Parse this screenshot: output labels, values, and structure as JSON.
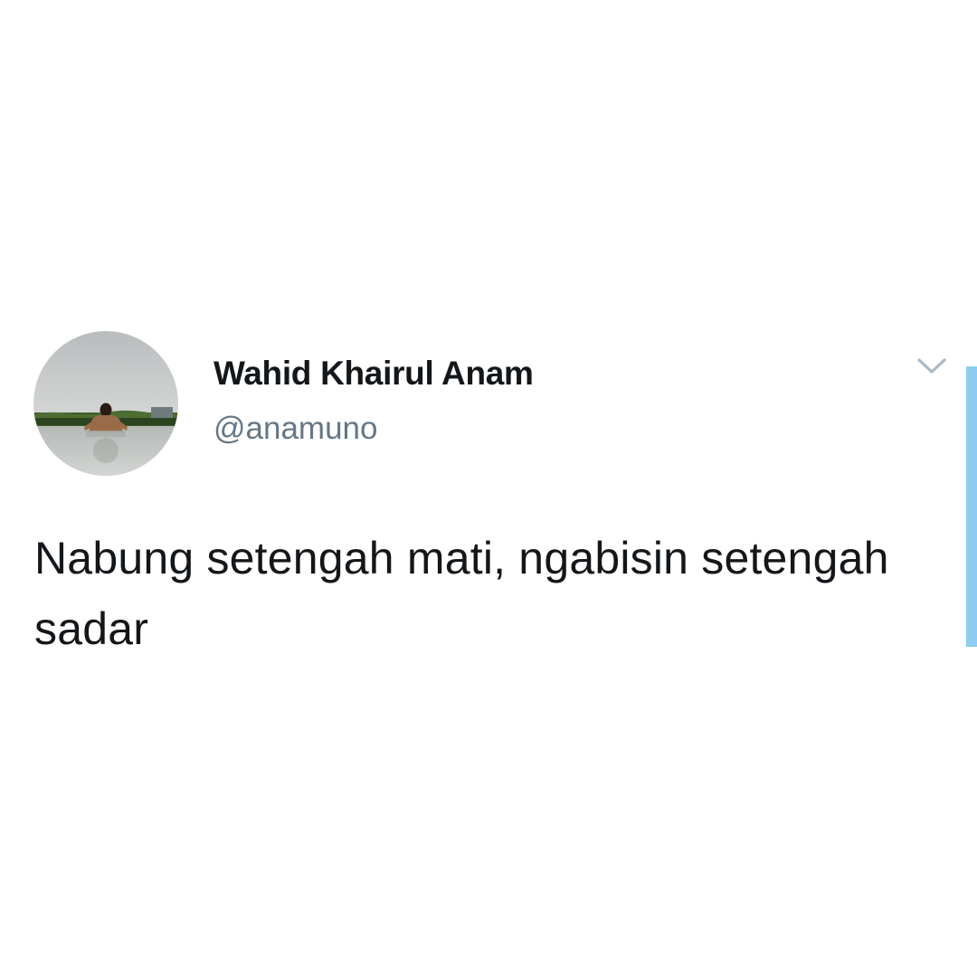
{
  "tweet": {
    "author": {
      "display_name": "Wahid Khairul Anam",
      "handle": "@anamuno",
      "avatar_icon": "profile-photo-person-in-water"
    },
    "text": "Nabung setengah mati, ngabisin setengah sadar",
    "menu_icon": "chevron-down-icon"
  },
  "colors": {
    "background": "#ffffff",
    "name_text": "#14171a",
    "handle_text": "#657786",
    "body_text": "#14171a",
    "chevron": "#aab8c2",
    "scroll_indicator": "#8ecdf0"
  }
}
